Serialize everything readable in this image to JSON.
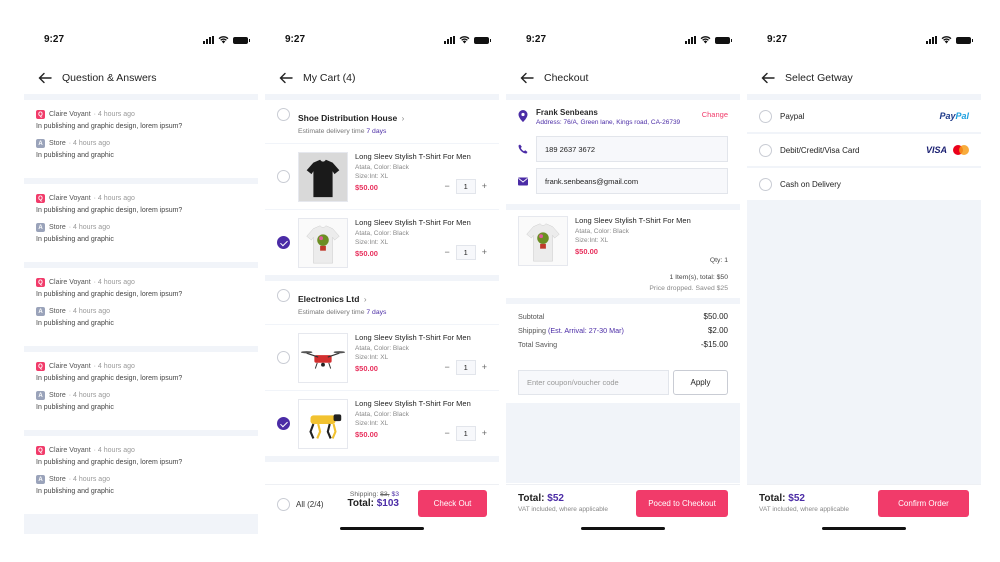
{
  "status": {
    "time": "9:27"
  },
  "qa": {
    "title": "Question & Answers",
    "items": [
      {
        "q_badge": "Q",
        "q_author": "Claire Voyant",
        "q_time": "4 hours ago",
        "q_text": "In publishing and graphic design, lorem ipsum?",
        "a_badge": "A",
        "a_author": "Store",
        "a_time": "4 hours ago",
        "a_text": "In publishing and graphic"
      },
      {
        "q_badge": "Q",
        "q_author": "Claire Voyant",
        "q_time": "4 hours ago",
        "q_text": "In publishing and graphic design, lorem ipsum?",
        "a_badge": "A",
        "a_author": "Store",
        "a_time": "4 hours ago",
        "a_text": "In publishing and graphic"
      },
      {
        "q_badge": "Q",
        "q_author": "Claire Voyant",
        "q_time": "4 hours ago",
        "q_text": "In publishing and graphic design, lorem ipsum?",
        "a_badge": "A",
        "a_author": "Store",
        "a_time": "4 hours ago",
        "a_text": "In publishing and graphic"
      },
      {
        "q_badge": "Q",
        "q_author": "Claire Voyant",
        "q_time": "4 hours ago",
        "q_text": "In publishing and graphic design, lorem ipsum?",
        "a_badge": "A",
        "a_author": "Store",
        "a_time": "4 hours ago",
        "a_text": "In publishing and graphic"
      },
      {
        "q_badge": "Q",
        "q_author": "Claire Voyant",
        "q_time": "4 hours ago",
        "q_text": "In publishing and graphic design, lorem ipsum?",
        "a_badge": "A",
        "a_author": "Store",
        "a_time": "4 hours ago",
        "a_text": "In publishing and graphic"
      }
    ]
  },
  "cart": {
    "title": "My Cart (4)",
    "stores": [
      {
        "name": "Shoe Distribution House",
        "delivery_prefix": "Estimate delivery time",
        "delivery_days": "7 days",
        "items": [
          {
            "name": "Long Sleev Stylish T-Shirt For Men",
            "meta1": "Atata, Color: Black",
            "meta2": "Size:Int: XL",
            "price": "$50.00",
            "qty": "1",
            "checked": false,
            "image": "black-tshirt"
          },
          {
            "name": "Long Sleev Stylish T-Shirt For Men",
            "meta1": "Atata, Color: Black",
            "meta2": "Size:Int: XL",
            "price": "$50.00",
            "qty": "1",
            "checked": true,
            "image": "white-tshirt"
          }
        ]
      },
      {
        "name": "Electronics Ltd",
        "delivery_prefix": "Estimate delivery time",
        "delivery_days": "7 days",
        "items": [
          {
            "name": "Long Sleev Stylish T-Shirt For Men",
            "meta1": "Atata, Color: Black",
            "meta2": "Size:Int: XL",
            "price": "$50.00",
            "qty": "1",
            "checked": false,
            "image": "drone"
          },
          {
            "name": "Long Sleev Stylish T-Shirt For Men",
            "meta1": "Atata, Color: Black",
            "meta2": "Size:Int: XL",
            "price": "$50.00",
            "qty": "1",
            "checked": true,
            "image": "robot-dog"
          }
        ]
      }
    ],
    "footer": {
      "all_label": "All (2/4)",
      "shipping_label": "Shipping:",
      "shipping_old": "$3,",
      "shipping_new": "$3",
      "total_label": "Total:",
      "total_value": "$103",
      "cta": "Check Out"
    }
  },
  "checkout": {
    "title": "Checkout",
    "address": {
      "name": "Frank Senbeans",
      "change": "Change",
      "line": "Address: 76/A, Green lane, Kings road, CA-26739"
    },
    "phone": "189 2637 3672",
    "email": "frank.senbeans@gmail.com",
    "item": {
      "name": "Long Sleev Stylish T-Shirt For Men",
      "meta1": "Atata, Color: Black",
      "meta2": "Size:Int: XL",
      "price": "$50.00",
      "qty": "Qty: 1"
    },
    "items_total": "1 Item(s), total: $50",
    "price_dropped": "Price dropped. Saved $25",
    "subtotal_label": "Subtotal",
    "subtotal_value": "$50.00",
    "shipping_label": "Shipping",
    "shipping_note": "(Est. Arrival: 27-30 Mar)",
    "shipping_value": "$2.00",
    "saving_label": "Total Saving",
    "saving_value": "-$15.00",
    "coupon_placeholder": "Enter coupon/voucher code",
    "apply": "Apply",
    "total_label": "Total:",
    "total_value": "$52",
    "vat": "VAT included, where applicable",
    "cta": "Poced to Checkout"
  },
  "gateway": {
    "title": "Select Getway",
    "options": [
      {
        "label": "Paypal",
        "logo": "PayPal"
      },
      {
        "label": "Debit/Credit/Visa Card",
        "logo": "VISA"
      },
      {
        "label": "Cash on Delivery",
        "logo": ""
      }
    ],
    "total_label": "Total:",
    "total_value": "$52",
    "vat": "VAT included, where applicable",
    "cta": "Confirm Order"
  },
  "colors": {
    "accent": "#f13b6a",
    "brand": "#4b2ca6",
    "bg": "#f1f4f9"
  }
}
